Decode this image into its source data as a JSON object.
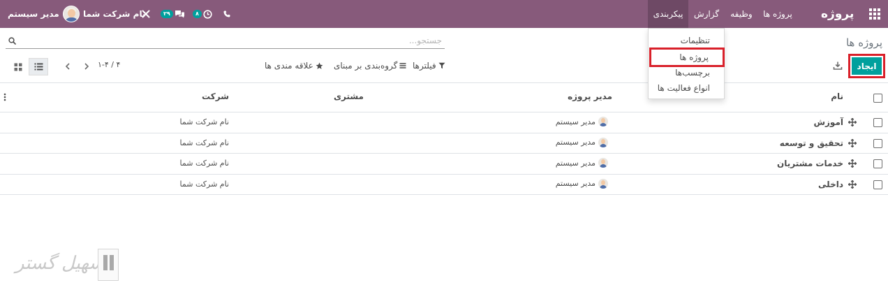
{
  "navbar": {
    "brand": "پروژه",
    "menu": [
      {
        "label": "پروژه ها"
      },
      {
        "label": "وظیفه"
      },
      {
        "label": "گزارش"
      },
      {
        "label": "پیکربندی"
      }
    ],
    "company": "نام شرکت شما",
    "user": "مدیر سیستم",
    "messages_badge": "۲۹",
    "activities_badge": "۸"
  },
  "config_menu": {
    "items": [
      {
        "label": "تنظیمات"
      },
      {
        "label": "پروژه ها"
      },
      {
        "label": "برچسب‌ها"
      },
      {
        "label": "انواع فعالیت ها"
      }
    ]
  },
  "control_panel": {
    "title": "پروژه ها",
    "search_placeholder": "جستجو...",
    "create_label": "ایجاد",
    "filters_label": "فیلترها",
    "groupby_label": "گروه‌بندی بر مبنای",
    "favorites_label": "علاقه مندی ها",
    "pager": "۱-۴ / ۴"
  },
  "table": {
    "columns": {
      "name": "نام",
      "manager": "مدیر پروژه",
      "customer": "مشتری",
      "company": "شرکت"
    },
    "rows": [
      {
        "name": "آموزش",
        "manager": "مدیر سیستم",
        "customer": "",
        "company": "نام شرکت شما"
      },
      {
        "name": "تحقیق و توسعه",
        "manager": "مدیر سیستم",
        "customer": "",
        "company": "نام شرکت شما"
      },
      {
        "name": "خدمات مشتریان",
        "manager": "مدیر سیستم",
        "customer": "",
        "company": "نام شرکت شما"
      },
      {
        "name": "داخلی",
        "manager": "مدیر سیستم",
        "customer": "",
        "company": "نام شرکت شما"
      }
    ]
  },
  "watermark": {
    "text": "تسهیل گستر"
  },
  "colors": {
    "navbar": "#875a7b",
    "navbar_active": "#6e4965",
    "primary_button": "#00a09d",
    "highlight_border": "#d9202a"
  }
}
